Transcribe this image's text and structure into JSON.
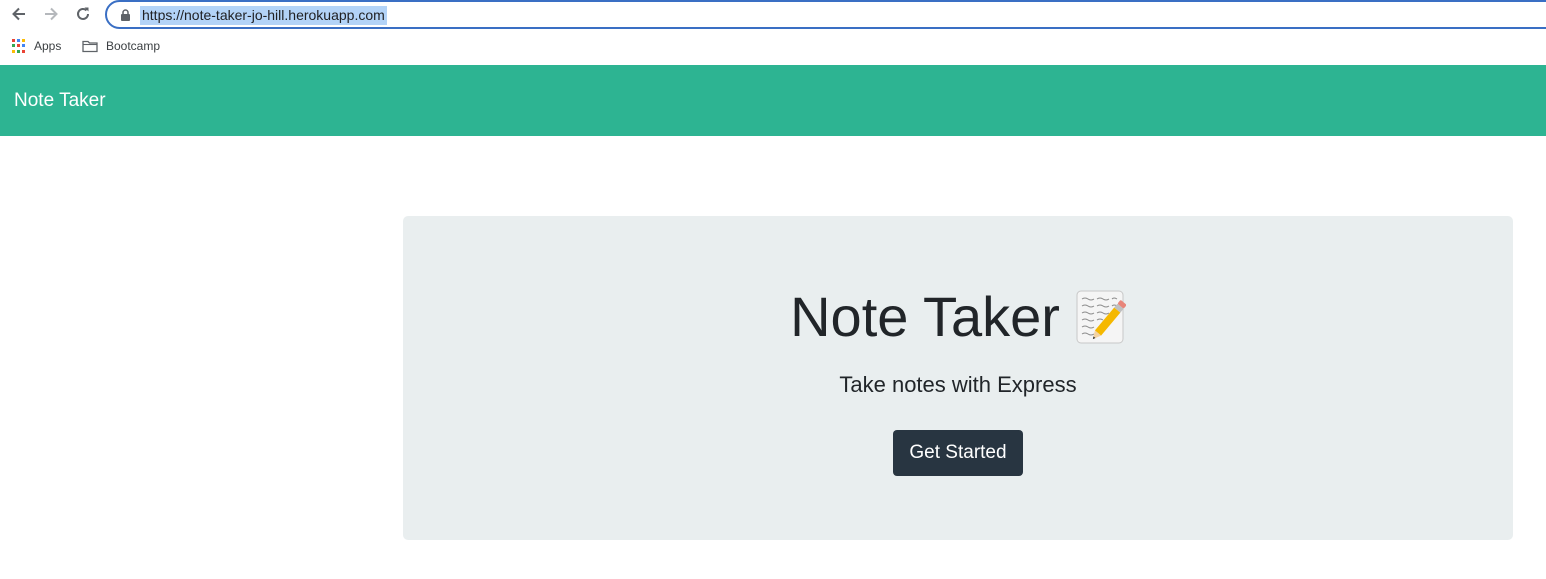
{
  "browser": {
    "url": "https://note-taker-jo-hill.herokuapp.com",
    "icons": {
      "back": "back-arrow-icon",
      "forward": "forward-arrow-icon",
      "reload": "reload-icon",
      "lock": "lock-icon"
    },
    "bookmarks": [
      {
        "label": "Apps",
        "icon": "apps-grid-icon"
      },
      {
        "label": "Bootcamp",
        "icon": "folder-icon"
      }
    ]
  },
  "navbar": {
    "brand": "Note Taker",
    "color": "#2db492"
  },
  "hero": {
    "title": "Note Taker",
    "icon": "memo-icon",
    "subtitle": "Take notes with Express",
    "button_label": "Get Started",
    "button_color": "#283541",
    "background": "#e9eeef"
  }
}
